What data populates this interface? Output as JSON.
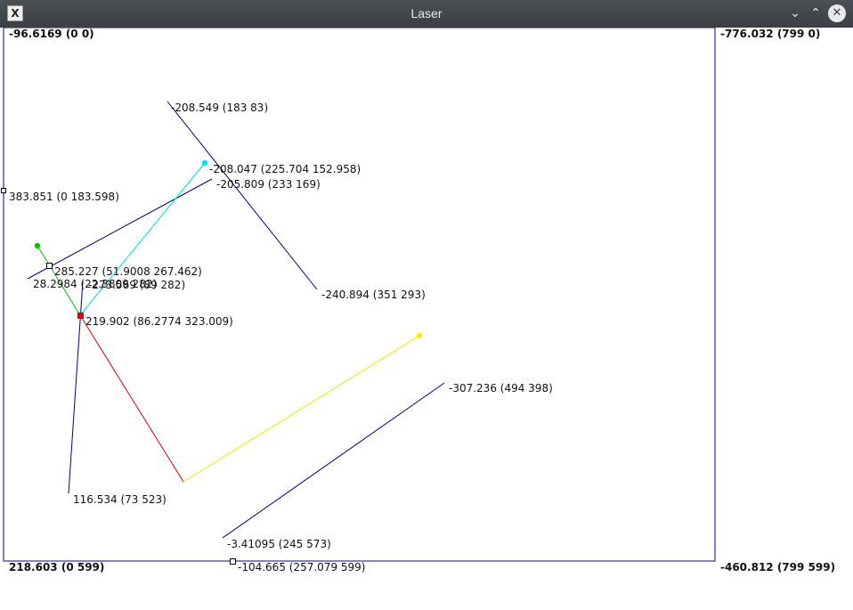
{
  "window": {
    "title": "Laser",
    "icon": "x-app-icon",
    "controls": {
      "minimize": "⌄",
      "maximize": "⌃",
      "close": "✕"
    }
  },
  "corners": {
    "top_left": "-96.6169 (0 0)",
    "top_right": "-776.032 (799 0)",
    "bottom_left": "218.603 (0 599)",
    "bottom_right": "-460.812 (799 599)"
  },
  "labels": {
    "l1": "-208.549 (183 83)",
    "l2": "-208.047 (225.704 152.958)",
    "l3": "-205.809 (233 169)",
    "l4": "383.851 (0 183.598)",
    "l5": "285.227 (51.9008 267.462)",
    "l6": "28.2984 (22.3809 282)",
    "l6b": "-273.569 (89 282)",
    "l7": "219.902 (86.2774 323.009)",
    "l8": "-240.894 (351 293)",
    "l9": "-307.236 (494 398)",
    "l10": "116.534 (73 523)",
    "l11": "-3.41095 (245 573)",
    "l12": "-104.665 (257.079 599)"
  },
  "colors": {
    "frame": "#0000a0",
    "wall": "#000080",
    "red_ray": "#dd0000",
    "yellow_ray": "#e8e800",
    "cyan_ray": "#00d8e8",
    "green_ray": "#00c000",
    "emitter": "#dd0000"
  }
}
